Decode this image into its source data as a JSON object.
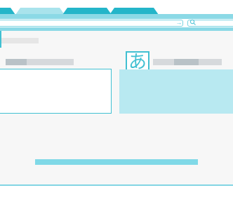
{
  "browser": {
    "tabs": [
      {
        "label": ""
      },
      {
        "label": ""
      },
      {
        "label": ""
      },
      {
        "label": ""
      }
    ],
    "address_value": "",
    "search_value": "",
    "go_icon": "→",
    "search_icon": "search-icon"
  },
  "page": {
    "title": "",
    "language_icon": "あ",
    "source_language_tabs": [
      "",
      "",
      ""
    ],
    "target_language_tabs": [
      "",
      "",
      ""
    ],
    "source_text": "",
    "translated_text": "",
    "action_label": ""
  },
  "colors": {
    "accent": "#24b5c9",
    "accent_light": "#8bd9e6",
    "output_background": "#b8e9f1",
    "segment_gray": "#d6d9dc"
  }
}
